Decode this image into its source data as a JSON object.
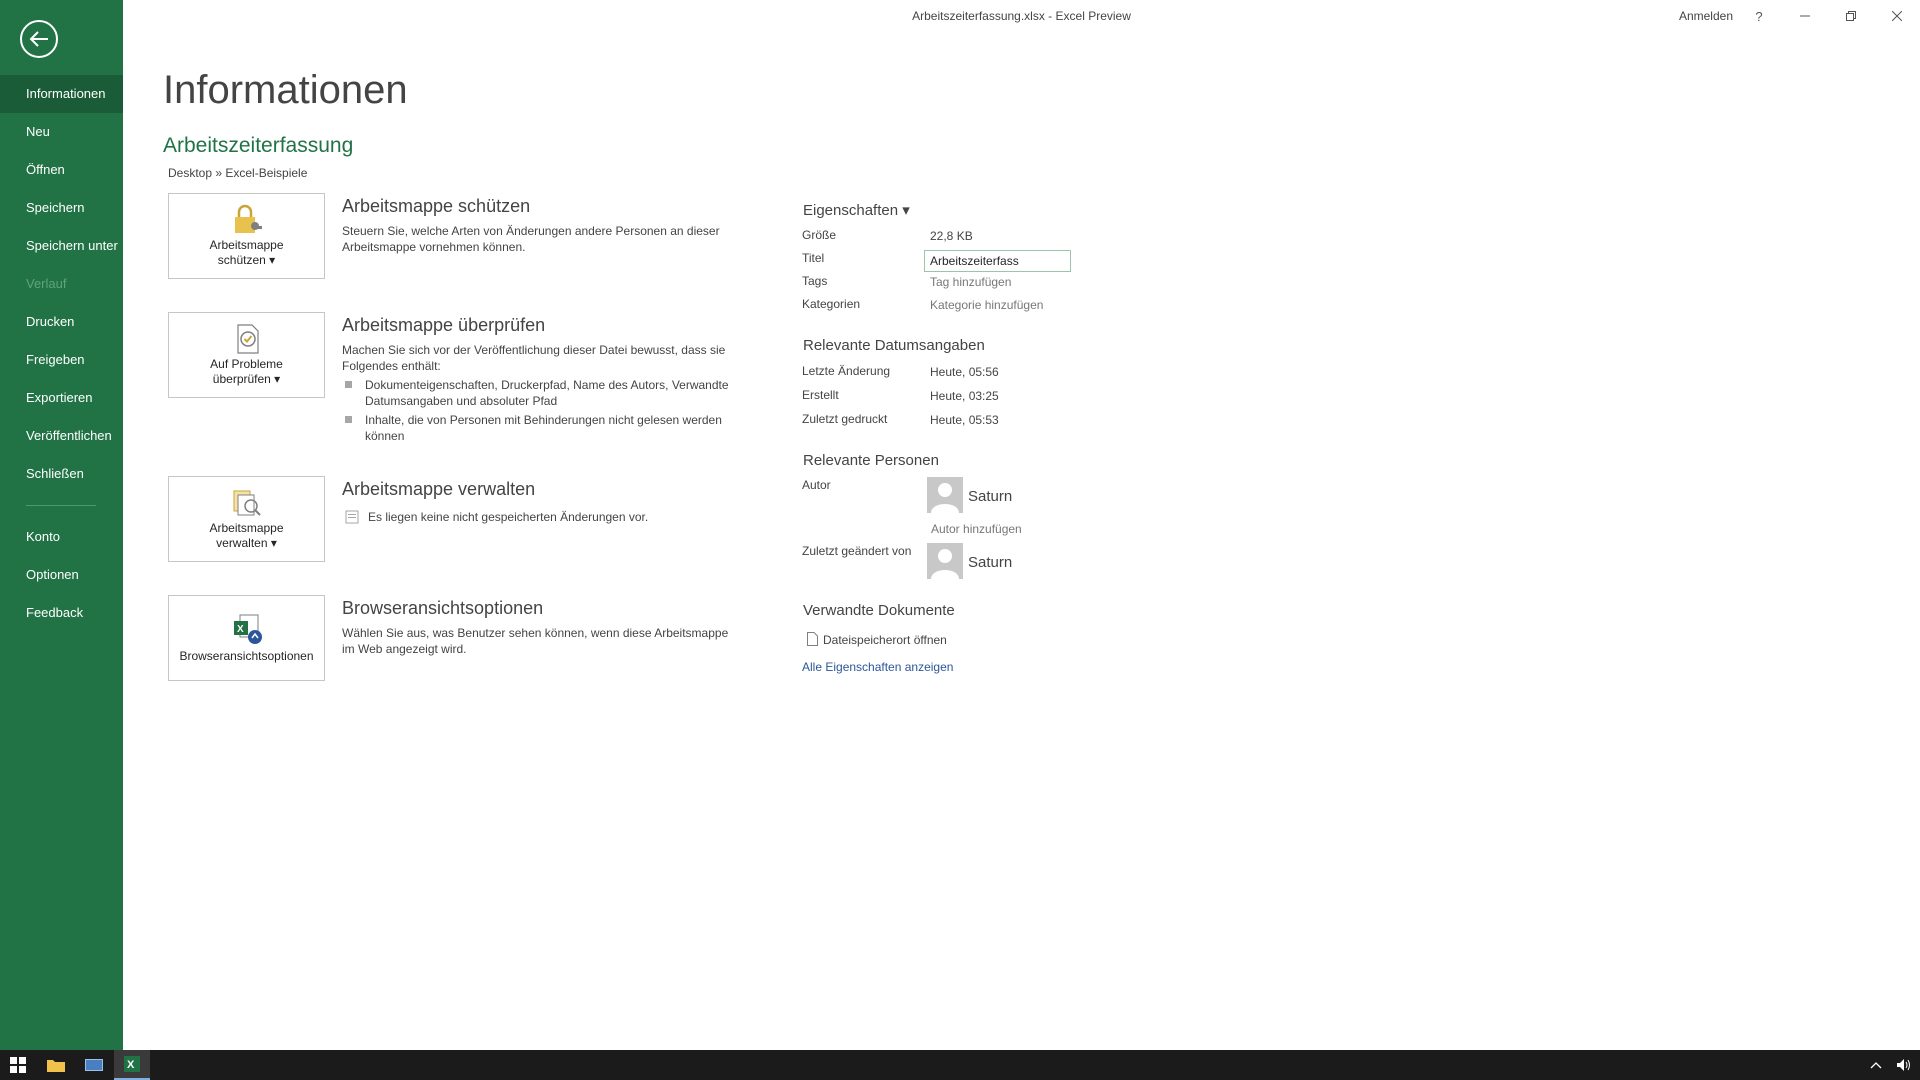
{
  "window": {
    "title": "Arbeitszeiterfassung.xlsx  -  Excel Preview",
    "sign_in": "Anmelden",
    "help": "?"
  },
  "sidebar": {
    "items": [
      {
        "label": "Informationen"
      },
      {
        "label": "Neu"
      },
      {
        "label": "Öffnen"
      },
      {
        "label": "Speichern"
      },
      {
        "label": "Speichern unter"
      },
      {
        "label": "Verlauf"
      },
      {
        "label": "Drucken"
      },
      {
        "label": "Freigeben"
      },
      {
        "label": "Exportieren"
      },
      {
        "label": "Veröffentlichen"
      },
      {
        "label": "Schließen"
      }
    ],
    "bottom_items": [
      {
        "label": "Konto"
      },
      {
        "label": "Optionen"
      },
      {
        "label": "Feedback"
      }
    ]
  },
  "main": {
    "page_title": "Informationen",
    "doc_name": "Arbeitszeiterfassung",
    "doc_path": "Desktop » Excel-Beispiele",
    "sections": [
      {
        "button_line1": "Arbeitsmappe",
        "button_line2": "schützen ▾",
        "title": "Arbeitsmappe schützen",
        "desc": "Steuern Sie, welche Arten von Änderungen andere Personen an dieser Arbeitsmappe vornehmen können."
      },
      {
        "button_line1": "Auf Probleme",
        "button_line2": "überprüfen ▾",
        "title": "Arbeitsmappe überprüfen",
        "desc": "Machen Sie sich vor der Veröffentlichung dieser Datei bewusst, dass sie Folgendes enthält:",
        "bullets": [
          "Dokumenteigenschaften, Druckerpfad, Name des Autors, Verwandte Datumsangaben und absoluter Pfad",
          "Inhalte, die von Personen mit Behinderungen nicht gelesen werden können"
        ]
      },
      {
        "button_line1": "Arbeitsmappe",
        "button_line2": "verwalten ▾",
        "title": "Arbeitsmappe verwalten",
        "desc": "Es liegen keine nicht gespeicherten Änderungen vor."
      },
      {
        "button_line1": "Browseransichtsoptionen",
        "title": "Browseransichtsoptionen",
        "desc": "Wählen Sie aus, was Benutzer sehen können, wenn diese Arbeitsmappe im Web angezeigt wird."
      }
    ]
  },
  "properties": {
    "heading": "Eigenschaften ▾",
    "size_label": "Größe",
    "size_value": "22,8 KB",
    "title_label": "Titel",
    "title_value": "Arbeitszeiterfass",
    "tags_label": "Tags",
    "tags_value": "Tag hinzufügen",
    "categories_label": "Kategorien",
    "categories_value": "Kategorie hinzufügen",
    "dates_heading": "Relevante Datumsangaben",
    "modified_label": "Letzte Änderung",
    "modified_value": "Heute, 05:56",
    "created_label": "Erstellt",
    "created_value": "Heute, 03:25",
    "printed_label": "Zuletzt gedruckt",
    "printed_value": "Heute, 05:53",
    "people_heading": "Relevante Personen",
    "author_label": "Autor",
    "author_name": "Saturn",
    "add_author": "Autor hinzufügen",
    "last_modified_by_label": "Zuletzt geändert von",
    "last_modified_by_name": "Saturn",
    "related_heading": "Verwandte Dokumente",
    "open_location": "Dateispeicherort öffnen",
    "show_all": "Alle Eigenschaften anzeigen"
  },
  "colors": {
    "excel_green": "#217346",
    "link_blue": "#2b579a"
  }
}
